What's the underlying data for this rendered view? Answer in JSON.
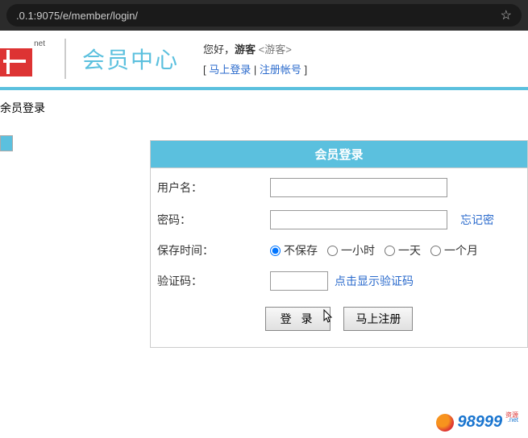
{
  "browser": {
    "url": ".0.1:9075/e/member/login/"
  },
  "header": {
    "logo_top": "net",
    "center_title": "会员中心",
    "greeting_prefix": "您好，",
    "greeting_user": "游客",
    "greeting_role": "<游客>",
    "login_link": "马上登录",
    "register_link": "注册帐号"
  },
  "breadcrumb": "余员登录",
  "panel": {
    "title": "会员登录"
  },
  "fields": {
    "username_label": "用户名：",
    "password_label": "密码：",
    "forgot_link": "忘记密",
    "savetime_label": "保存时间：",
    "captcha_label": "验证码：",
    "captcha_link": "点击显示验证码"
  },
  "radios": {
    "r0": "不保存",
    "r1": "一小时",
    "r2": "一天",
    "r3": "一个月"
  },
  "buttons": {
    "login": "登 录",
    "register": "马上注册"
  },
  "footer": {
    "brand_num": "98999",
    "brand_suffix_top": "资源",
    "brand_suffix_bot": ".net"
  }
}
